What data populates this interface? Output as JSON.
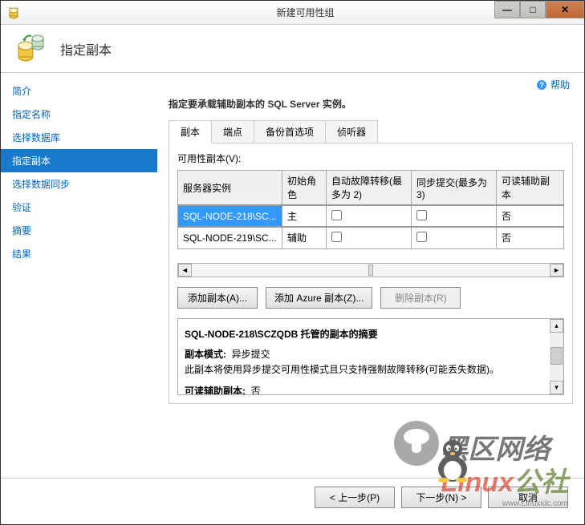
{
  "window": {
    "title": "新建可用性组"
  },
  "page": {
    "title": "指定副本"
  },
  "sidebar": {
    "items": [
      {
        "label": "简介"
      },
      {
        "label": "指定名称"
      },
      {
        "label": "选择数据库"
      },
      {
        "label": "指定副本"
      },
      {
        "label": "选择数据同步"
      },
      {
        "label": "验证"
      },
      {
        "label": "摘要"
      },
      {
        "label": "结果"
      }
    ]
  },
  "help": {
    "label": "帮助"
  },
  "main": {
    "instruction": "指定要承载辅助副本的 SQL Server 实例。",
    "tabs": [
      {
        "label": "副本"
      },
      {
        "label": "端点"
      },
      {
        "label": "备份首选项"
      },
      {
        "label": "侦听器"
      }
    ],
    "section_label": "可用性副本(V):",
    "table": {
      "headers": {
        "server": "服务器实例",
        "initial_role": "初始角色",
        "auto_failover": "自动故障转移(最多为 2)",
        "sync_commit": "同步提交(最多为 3)",
        "readable": "可读辅助副本"
      },
      "rows": [
        {
          "server": "SQL-NODE-218\\SC...",
          "role": "主",
          "readable": "否"
        },
        {
          "server": "SQL-NODE-219\\SC...",
          "role": "辅助",
          "readable": "否"
        }
      ]
    },
    "buttons": {
      "add_replica": "添加副本(A)...",
      "add_azure": "添加 Azure 副本(Z)...",
      "delete_replica": "删除副本(R)"
    },
    "summary": {
      "title": "SQL-NODE-218\\SCZQDB 托管的副本的摘要",
      "mode_label": "副本模式:",
      "mode_value": "异步提交",
      "mode_desc": "此副本将使用异步提交可用性模式且只支持强制故障转移(可能丢失数据)。",
      "readable_label": "可读辅助副本:",
      "readable_value": "否"
    }
  },
  "footer": {
    "prev": "< 上一步(P)",
    "next": "下一步(N) >",
    "cancel": "取消"
  },
  "watermark": {
    "text1": "黑区网络",
    "text2": "Linux",
    "url": "www.Linuxidc.com"
  }
}
